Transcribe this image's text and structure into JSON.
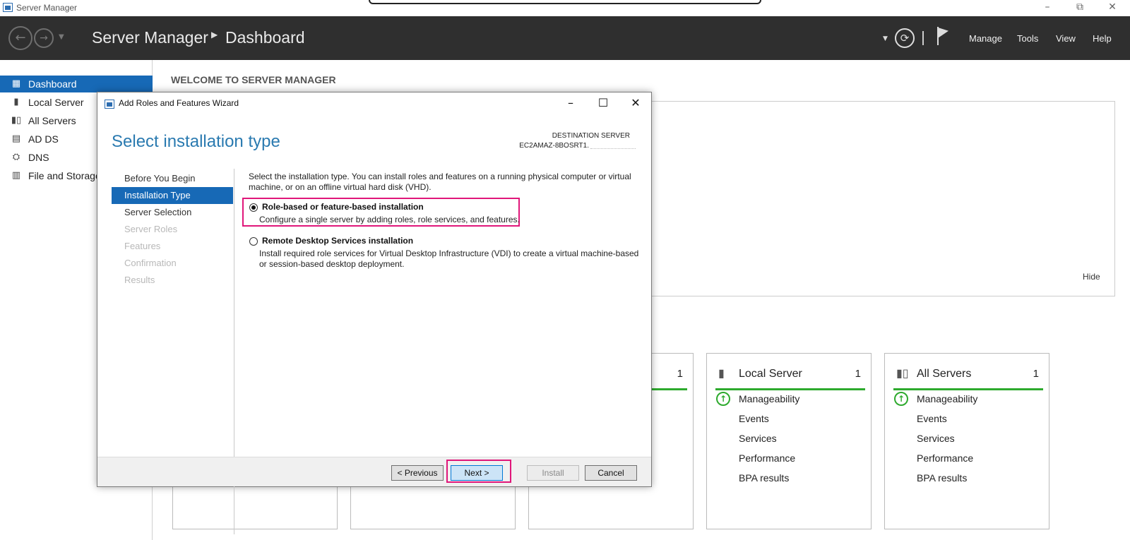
{
  "window": {
    "title": "Server Manager",
    "controls": {
      "minimize": "–",
      "restore": "⧉",
      "close": "✕"
    }
  },
  "header": {
    "breadcrumb": [
      "Server Manager",
      "Dashboard"
    ],
    "menus": {
      "manage": "Manage",
      "tools": "Tools",
      "view": "View",
      "help": "Help"
    },
    "icons": [
      "back-icon",
      "forward-icon",
      "dropdown-icon",
      "refresh-icon",
      "notifications-flag-icon"
    ]
  },
  "sidebar": {
    "items": [
      {
        "label": "Dashboard",
        "icon": "dashboard-icon",
        "active": true
      },
      {
        "label": "Local Server",
        "icon": "server-icon"
      },
      {
        "label": "All Servers",
        "icon": "servers-icon"
      },
      {
        "label": "AD DS",
        "icon": "ad-ds-icon"
      },
      {
        "label": "DNS",
        "icon": "dns-icon"
      },
      {
        "label": "File and Storage",
        "icon": "file-storage-icon"
      }
    ]
  },
  "main": {
    "welcome": "WELCOME TO SERVER MANAGER",
    "hide": "Hide",
    "tiles": [
      {
        "title": "",
        "count": "1"
      },
      {
        "title": "Local Server",
        "count": "1",
        "rows": [
          "Manageability",
          "Events",
          "Services",
          "Performance",
          "BPA results"
        ]
      },
      {
        "title": "All Servers",
        "count": "1",
        "rows": [
          "Manageability",
          "Events",
          "Services",
          "Performance",
          "BPA results"
        ]
      }
    ]
  },
  "wizard": {
    "title": "Add Roles and Features Wizard",
    "heading": "Select installation type",
    "destination_label": "DESTINATION SERVER",
    "destination_value": "EC2AMAZ-8BOSRT1.",
    "steps": [
      {
        "label": "Before You Begin",
        "state": "done"
      },
      {
        "label": "Installation Type",
        "state": "active"
      },
      {
        "label": "Server Selection",
        "state": "done"
      },
      {
        "label": "Server Roles",
        "state": "todo"
      },
      {
        "label": "Features",
        "state": "todo"
      },
      {
        "label": "Confirmation",
        "state": "todo"
      },
      {
        "label": "Results",
        "state": "todo"
      }
    ],
    "description": "Select the installation type. You can install roles and features on a running physical computer or virtual machine, or on an offline virtual hard disk (VHD).",
    "options": [
      {
        "title": "Role-based or feature-based installation",
        "desc": "Configure a single server by adding roles, role services, and features.",
        "selected": true
      },
      {
        "title": "Remote Desktop Services installation",
        "desc": "Install required role services for Virtual Desktop Infrastructure (VDI) to create a virtual machine-based or session-based desktop deployment.",
        "selected": false
      }
    ],
    "buttons": {
      "previous": "< Previous",
      "next": "Next >",
      "install": "Install",
      "cancel": "Cancel"
    }
  },
  "colors": {
    "accent": "#1769b6",
    "heading": "#2a7ab0",
    "highlight": "#e0177a",
    "ok": "#2eaa2e"
  }
}
